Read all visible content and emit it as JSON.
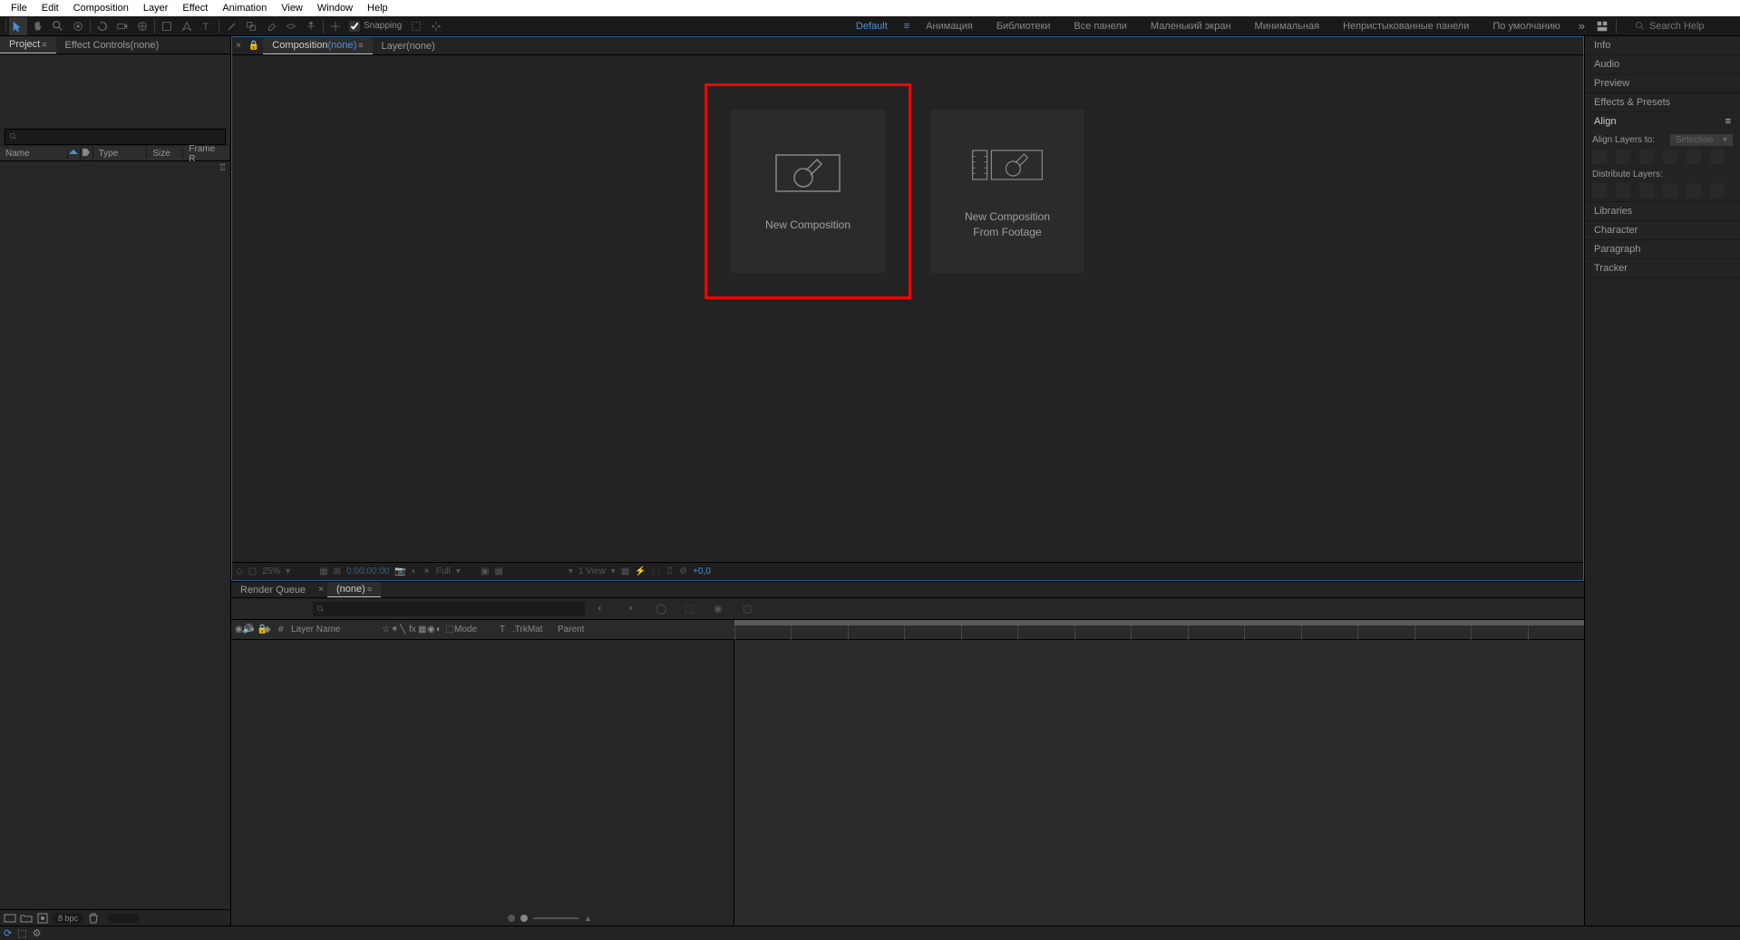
{
  "menubar": [
    "File",
    "Edit",
    "Composition",
    "Layer",
    "Effect",
    "Animation",
    "View",
    "Window",
    "Help"
  ],
  "toolbar": {
    "snapping": "Snapping",
    "workspaces": [
      "Default",
      "Анимация",
      "Библиотеки",
      "Все панели",
      "Маленький экран",
      "Минимальная",
      "Непристыкованные панели",
      "По умолчанию"
    ],
    "search_placeholder": "Search Help"
  },
  "left_tabs": {
    "project": "Project",
    "effect_controls": "Effect Controls",
    "effect_controls_none": "(none)"
  },
  "project_cols": {
    "name": "Name",
    "type": "Type",
    "size": "Size",
    "framerate": "Frame R"
  },
  "project_footer": {
    "bpc": "8 bpc"
  },
  "comp_tabs": {
    "composition": "Composition",
    "comp_none": "(none)",
    "layer": "Layer",
    "layer_none": "(none)"
  },
  "welcome": {
    "new_comp": "New Composition",
    "new_from_footage_1": "New Composition",
    "new_from_footage_2": "From Footage"
  },
  "comp_footer": {
    "zoom": "25%",
    "timecode": "0:00:00:00",
    "quality": "Full",
    "view": "1 View",
    "adjust": "+0,0"
  },
  "timeline_tabs": {
    "render_queue": "Render Queue",
    "none": "(none)"
  },
  "tl_cols": {
    "hash": "#",
    "layer_name": "Layer Name",
    "mode": "Mode",
    "t": "T",
    "trkmat": ".TrkMat",
    "parent": "Parent"
  },
  "right_panels": {
    "info": "Info",
    "audio": "Audio",
    "preview": "Preview",
    "effects_presets": "Effects & Presets",
    "align": "Align",
    "align_layers": "Align Layers to:",
    "align_selection": "Selection",
    "distribute": "Distribute Layers:",
    "libraries": "Libraries",
    "character": "Character",
    "paragraph": "Paragraph",
    "tracker": "Tracker"
  }
}
